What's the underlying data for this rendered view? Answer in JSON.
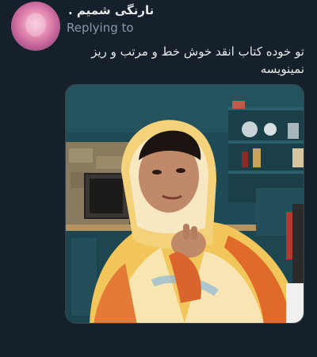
{
  "tweet": {
    "display_name": "نارنگی شمیم .",
    "replying_label": "Replying to",
    "text": "تو خوده کتاب انقد خوش خط و مرتب و ریز نمینویسه"
  },
  "media": {
    "alt": "meme image of a man wrapped in a yellow, white and orange striped blanket"
  },
  "colors": {
    "background": "#15202b",
    "text": "#e7e9ea",
    "secondary": "#8b98a5"
  },
  "icons": [
    "avatar-image"
  ]
}
